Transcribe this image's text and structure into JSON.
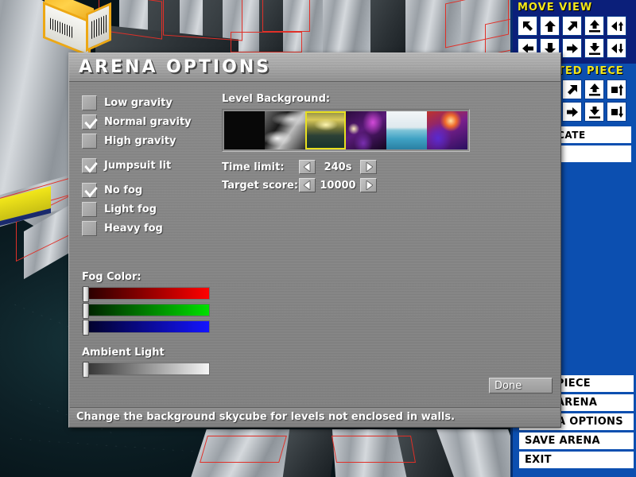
{
  "dialog": {
    "title": "ARENA OPTIONS",
    "status_text": "Change the background skycube for levels not enclosed in walls.",
    "done_label": "Done",
    "checkboxes": [
      {
        "label": "Low gravity",
        "checked": false,
        "group_gap": false
      },
      {
        "label": "Normal gravity",
        "checked": true,
        "group_gap": false
      },
      {
        "label": "High gravity",
        "checked": false,
        "group_gap": false
      },
      {
        "label": "Jumpsuit lit",
        "checked": true,
        "group_gap": true
      },
      {
        "label": "No fog",
        "checked": true,
        "group_gap": true
      },
      {
        "label": "Light fog",
        "checked": false,
        "group_gap": false
      },
      {
        "label": "Heavy fog",
        "checked": false,
        "group_gap": false
      }
    ],
    "level_background": {
      "label": "Level Background:",
      "selected_index": 2,
      "thumbnails": [
        {
          "name": "black-skycube",
          "selected": false
        },
        {
          "name": "grey-cloud-skycube",
          "selected": false
        },
        {
          "name": "yellow-sunset-skycube",
          "selected": true
        },
        {
          "name": "purple-nebula-skycube",
          "selected": false
        },
        {
          "name": "blue-ocean-skycube",
          "selected": false
        },
        {
          "name": "red-planet-skycube",
          "selected": false
        }
      ]
    },
    "spinners": [
      {
        "label": "Time limit:",
        "value": "240s",
        "dec_icon": "left-arrow-icon",
        "inc_icon": "right-arrow-icon"
      },
      {
        "label": "Target score:",
        "value": "10000",
        "dec_icon": "left-arrow-icon",
        "inc_icon": "right-arrow-icon"
      }
    ],
    "fog_color": {
      "label": "Fog Color:",
      "channels": [
        {
          "name": "red",
          "color": "#ff0000",
          "handle_pct": 0
        },
        {
          "name": "green",
          "color": "#00e000",
          "handle_pct": 0
        },
        {
          "name": "blue",
          "color": "#1414ff",
          "handle_pct": 0
        }
      ]
    },
    "ambient_light": {
      "label": "Ambient Light",
      "handle_pct": 0
    }
  },
  "hud": {
    "move_view": {
      "title": "MOVE VIEW",
      "buttons": [
        "arrow-up-left-icon",
        "arrow-up-icon",
        "arrow-up-right-icon",
        "arrow-up-flat-icon",
        "arrow-left-tilt-up-icon",
        "arrow-left-icon",
        "arrow-down-icon",
        "arrow-right-icon",
        "arrow-down-flat-icon",
        "arrow-left-tilt-down-icon"
      ]
    },
    "selected_piece": {
      "title": "SELECTED PIECE",
      "buttons": [
        "arrow-up-left-icon",
        "arrow-up-icon",
        "arrow-up-right-icon",
        "arrow-raise-icon",
        "block-up-icon",
        "arrow-left-icon",
        "arrow-down-icon",
        "arrow-right-icon",
        "arrow-lower-icon",
        "block-down-icon"
      ],
      "duplicate_label": "DUPLICATE"
    },
    "menu": [
      "NEW PIECE",
      "NEW ARENA",
      "ARENA OPTIONS",
      "SAVE ARENA",
      "EXIT"
    ]
  },
  "colors": {
    "hud_blue": "#0c4fb0",
    "hud_dark_blue": "#0b1f7a",
    "hud_yellow": "#f2e61b",
    "selection_yellow": "#e8e020",
    "dialog_grey": "#878787"
  }
}
